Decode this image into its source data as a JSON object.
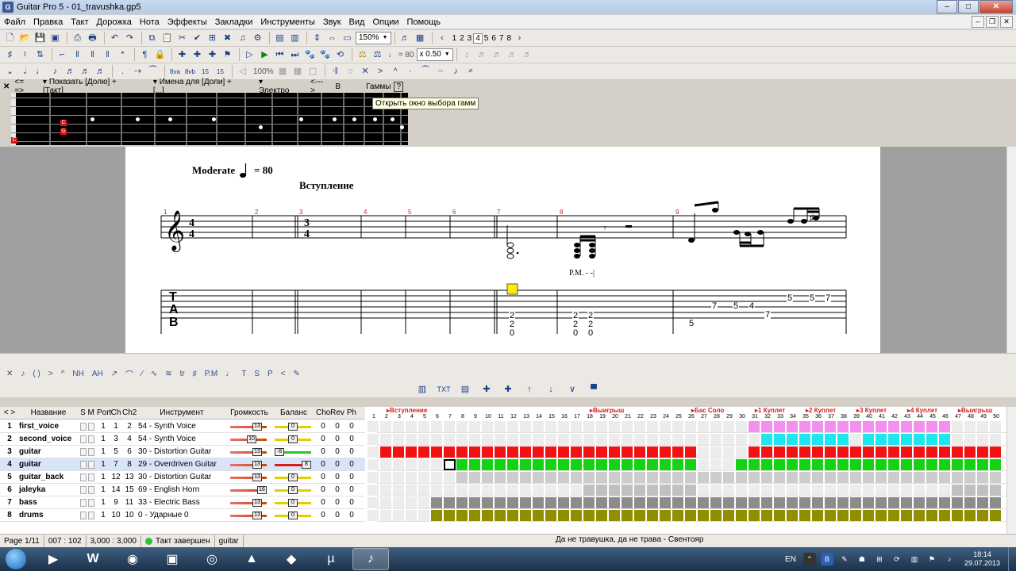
{
  "window": {
    "title": "Guitar Pro 5 - 01_travushka.gp5"
  },
  "menu": [
    "Файл",
    "Правка",
    "Такт",
    "Дорожка",
    "Нота",
    "Эффекты",
    "Закладки",
    "Инструменты",
    "Звук",
    "Вид",
    "Опции",
    "Помощь"
  ],
  "toolbar1": {
    "zoom": "150%",
    "pages": [
      "1",
      "2",
      "3",
      "4",
      "5",
      "6",
      "7",
      "8"
    ],
    "active_page": "4"
  },
  "toolbar2": {
    "tempo_note": "= 80",
    "speed": "x 0.50"
  },
  "toolbar3": {
    "zoom_disabled": "100%"
  },
  "fretboard": {
    "nav": "<= =>",
    "show": "Показать [Долю] + [Такт]",
    "names": "Имена для [Доли] + [...]",
    "tuning": "Электро",
    "arrows": "<--->",
    "key": "В",
    "scales": "Гаммы",
    "help": "?",
    "note_c": "C",
    "note_g": "G",
    "note_c2": "C"
  },
  "tooltip": "Открыть окно выбора гамм",
  "score": {
    "tempo_word": "Moderate",
    "tempo_value": "= 80",
    "section": "Вступление",
    "bar_numbers": [
      "1",
      "2",
      "3",
      "4",
      "5",
      "6",
      "7",
      "8",
      "9"
    ],
    "pm": "P.M. - -|",
    "tab_label": [
      "T",
      "A",
      "B"
    ],
    "tab_numbers": [
      {
        "v": "2"
      },
      {
        "v": "2"
      },
      {
        "v": "0"
      },
      {
        "v": "2"
      },
      {
        "v": "2"
      },
      {
        "v": "0"
      },
      {
        "v": "2"
      },
      {
        "v": "2"
      },
      {
        "v": "0"
      },
      {
        "v": "7"
      },
      {
        "v": "5"
      },
      {
        "v": "4"
      },
      {
        "v": "7"
      },
      {
        "v": "5"
      },
      {
        "v": "5"
      },
      {
        "v": "5"
      },
      {
        "v": "7"
      }
    ]
  },
  "effects_bar": [
    "tr",
    "P.M",
    "T",
    "S",
    "P"
  ],
  "tracks_toolbar": {
    "txt": "TXT"
  },
  "track_header": {
    "nav": "< >",
    "name": "Название",
    "sm": "S M",
    "port": "Port",
    "ch": "Ch",
    "ch2": "Ch2",
    "instrument": "Инструмент",
    "volume": "Громкость",
    "balance": "Баланс",
    "cho": "Cho",
    "rev": "Rev",
    "ph": "Ph"
  },
  "tracks": [
    {
      "num": "1",
      "name": "first_voice",
      "port": "1",
      "ch": "1",
      "ch2": "2",
      "instrument": "54 - Synth Voice",
      "vol": "13",
      "bal": "0",
      "cho": "0",
      "rev": "0",
      "ph": "0",
      "color": "#f48ff0"
    },
    {
      "num": "2",
      "name": "second_voice",
      "port": "1",
      "ch": "3",
      "ch2": "4",
      "instrument": "54 - Synth Voice",
      "vol": "10",
      "bal": "0",
      "cho": "0",
      "rev": "0",
      "ph": "0",
      "color": "#1ee5f0"
    },
    {
      "num": "3",
      "name": "guitar",
      "port": "1",
      "ch": "5",
      "ch2": "6",
      "instrument": "30 - Distortion Guitar",
      "vol": "13",
      "bal": "-8",
      "cho": "0",
      "rev": "0",
      "ph": "0",
      "color": "#f11313"
    },
    {
      "num": "4",
      "name": "guitar",
      "port": "1",
      "ch": "7",
      "ch2": "8",
      "instrument": "29 - Overdriven Guitar",
      "vol": "13",
      "bal": "8",
      "cho": "0",
      "rev": "0",
      "ph": "0",
      "color": "#13d313"
    },
    {
      "num": "5",
      "name": "guitar_back",
      "port": "1",
      "ch": "12",
      "ch2": "13",
      "instrument": "30 - Distortion Guitar",
      "vol": "13",
      "bal": "0",
      "cho": "0",
      "rev": "0",
      "ph": "0",
      "color": "#cccccc"
    },
    {
      "num": "6",
      "name": "jaleyka",
      "port": "1",
      "ch": "14",
      "ch2": "15",
      "instrument": "69 - English Horn",
      "vol": "16",
      "bal": "0",
      "cho": "0",
      "rev": "0",
      "ph": "0",
      "color": "#c0c0c0"
    },
    {
      "num": "7",
      "name": "bass",
      "port": "1",
      "ch": "9",
      "ch2": "11",
      "instrument": "33 - Electric Bass (finger)",
      "vol": "13",
      "bal": "0",
      "cho": "0",
      "rev": "0",
      "ph": "0",
      "color": "#8c8c8c"
    },
    {
      "num": "8",
      "name": "drums",
      "port": "1",
      "ch": "10",
      "ch2": "10",
      "instrument": "0 - Ударные 0",
      "vol": "13",
      "bal": "0",
      "cho": "0",
      "rev": "0",
      "ph": "0",
      "color": "#8f8f00"
    }
  ],
  "timeline": {
    "sections": [
      {
        "label": "Вступление",
        "bar": 2
      },
      {
        "label": "Выигрыш",
        "bar": 18
      },
      {
        "label": "Бас Соло",
        "bar": 26
      },
      {
        "label": "1 Куплет",
        "bar": 31
      },
      {
        "label": "2 Куплет",
        "bar": 35
      },
      {
        "label": "3 Куплет",
        "bar": 39
      },
      {
        "label": "4 Куплет",
        "bar": 43
      },
      {
        "label": "Выигрыш",
        "bar": 47
      }
    ],
    "bar_count": 50
  },
  "status": {
    "page": "Page 1/11",
    "pos": "007 : 102",
    "time": "3,000 : 3,000",
    "bar_state": "Такт завершен",
    "track": "guitar",
    "song": "Да не травушка, да не трава - Свентояр"
  },
  "taskbar": {
    "lang": "EN",
    "time": "18:14",
    "date": "29.07.2013"
  }
}
